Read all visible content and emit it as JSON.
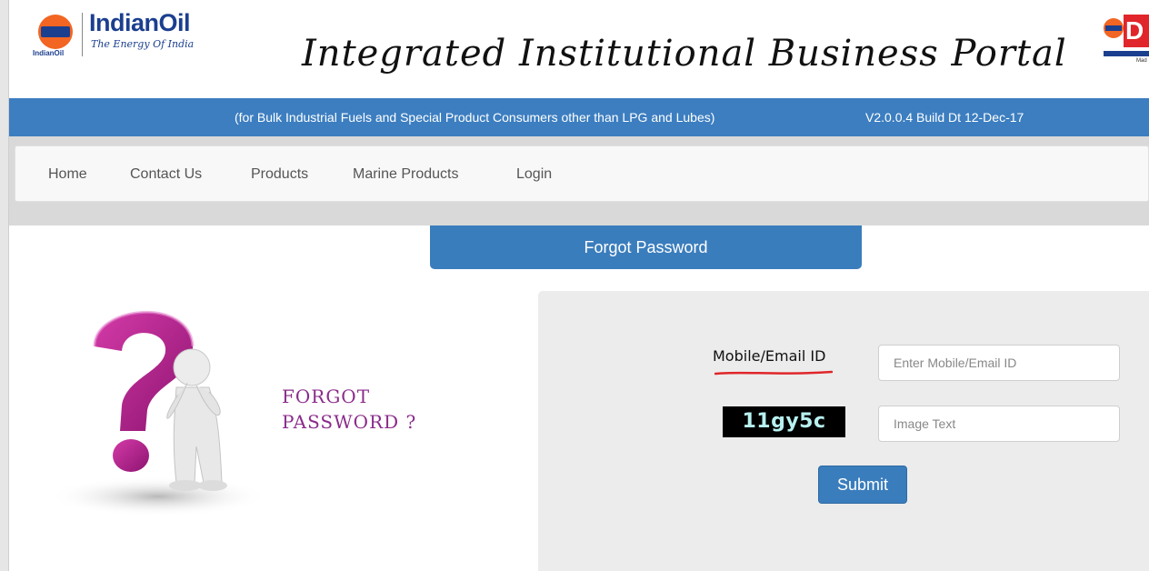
{
  "header": {
    "logo_name": "IndianOil",
    "logo_tagline": "The Energy Of India",
    "logo_sub": "IndianOil",
    "portal_title": "Integrated Institutional Business Portal"
  },
  "info_bar": {
    "text": "(for Bulk Industrial Fuels and Special Product Consumers other than LPG and Lubes)",
    "version": "V2.0.0.4 Build Dt 12-Dec-17",
    "color": "#3c7ec0"
  },
  "nav": {
    "items": [
      {
        "label": "Home"
      },
      {
        "label": "Contact Us"
      },
      {
        "label": "Products"
      },
      {
        "label": "Marine Products"
      },
      {
        "label": "Login"
      }
    ]
  },
  "form": {
    "title": "Forgot Password",
    "illustration_text_line1": "FORGOT",
    "illustration_text_line2": "PASSWORD ?",
    "id_label": "Mobile/Email ID",
    "id_value": "",
    "id_placeholder": "Enter Mobile/Email ID",
    "captcha_text": "11gy5c",
    "captcha_value": "",
    "captcha_placeholder": "Image Text",
    "submit_label": "Submit"
  },
  "colors": {
    "accent": "#3a7dbd",
    "panel": "#ececec",
    "forgot_text": "#8b2c8b",
    "question_mark": "#b21f8d"
  },
  "icons": {
    "illustration": "question-mark-thinking-figure"
  }
}
